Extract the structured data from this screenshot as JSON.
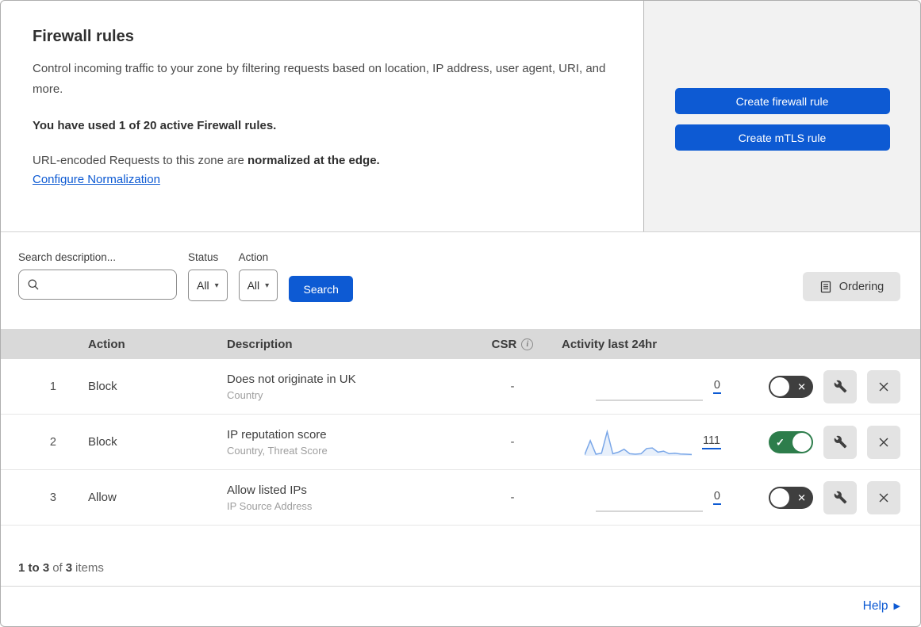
{
  "header": {
    "title": "Firewall rules",
    "description": "Control incoming traffic to your zone by filtering requests based on location, IP address, user agent, URI, and more.",
    "usage_note": "You have used 1 of 20 active Firewall rules.",
    "normalization_prefix": "URL-encoded Requests to this zone are ",
    "normalization_bold": "normalized at the edge.",
    "normalization_link": "Configure Normalization",
    "create_firewall_button": "Create firewall rule",
    "create_mtls_button": "Create mTLS rule"
  },
  "filters": {
    "search_label": "Search description...",
    "search_value": "",
    "status_label": "Status",
    "status_value": "All",
    "action_label": "Action",
    "action_value": "All",
    "search_button": "Search",
    "ordering_button": "Ordering"
  },
  "table": {
    "columns": {
      "action": "Action",
      "description": "Description",
      "csr": "CSR",
      "activity": "Activity last 24hr"
    },
    "rows": [
      {
        "priority": "1",
        "action": "Block",
        "description": "Does not originate in UK",
        "fields": "Country",
        "csr": "-",
        "activity_count": "0",
        "enabled": false,
        "sparkline": []
      },
      {
        "priority": "2",
        "action": "Block",
        "description": "IP reputation score",
        "fields": "Country, Threat Score",
        "csr": "-",
        "activity_count": "111",
        "enabled": true,
        "sparkline": [
          4,
          58,
          6,
          10,
          92,
          8,
          14,
          25,
          8,
          6,
          8,
          28,
          30,
          14,
          18,
          8,
          10,
          7,
          6,
          5
        ]
      },
      {
        "priority": "3",
        "action": "Allow",
        "description": "Allow listed IPs",
        "fields": "IP Source Address",
        "csr": "-",
        "activity_count": "0",
        "enabled": false,
        "sparkline": []
      }
    ]
  },
  "footer": {
    "range": "1 to 3",
    "of_word": "of",
    "total": "3",
    "items_word": "items",
    "help_label": "Help"
  },
  "colors": {
    "accent_blue": "#0d5ad3",
    "toggle_green": "#2d7d4b",
    "toggle_off": "#3f3f3f",
    "sparkline_line": "#7aa7e8",
    "sparkline_fill": "#e8f0fb",
    "flat_line": "#c9c9c9"
  }
}
